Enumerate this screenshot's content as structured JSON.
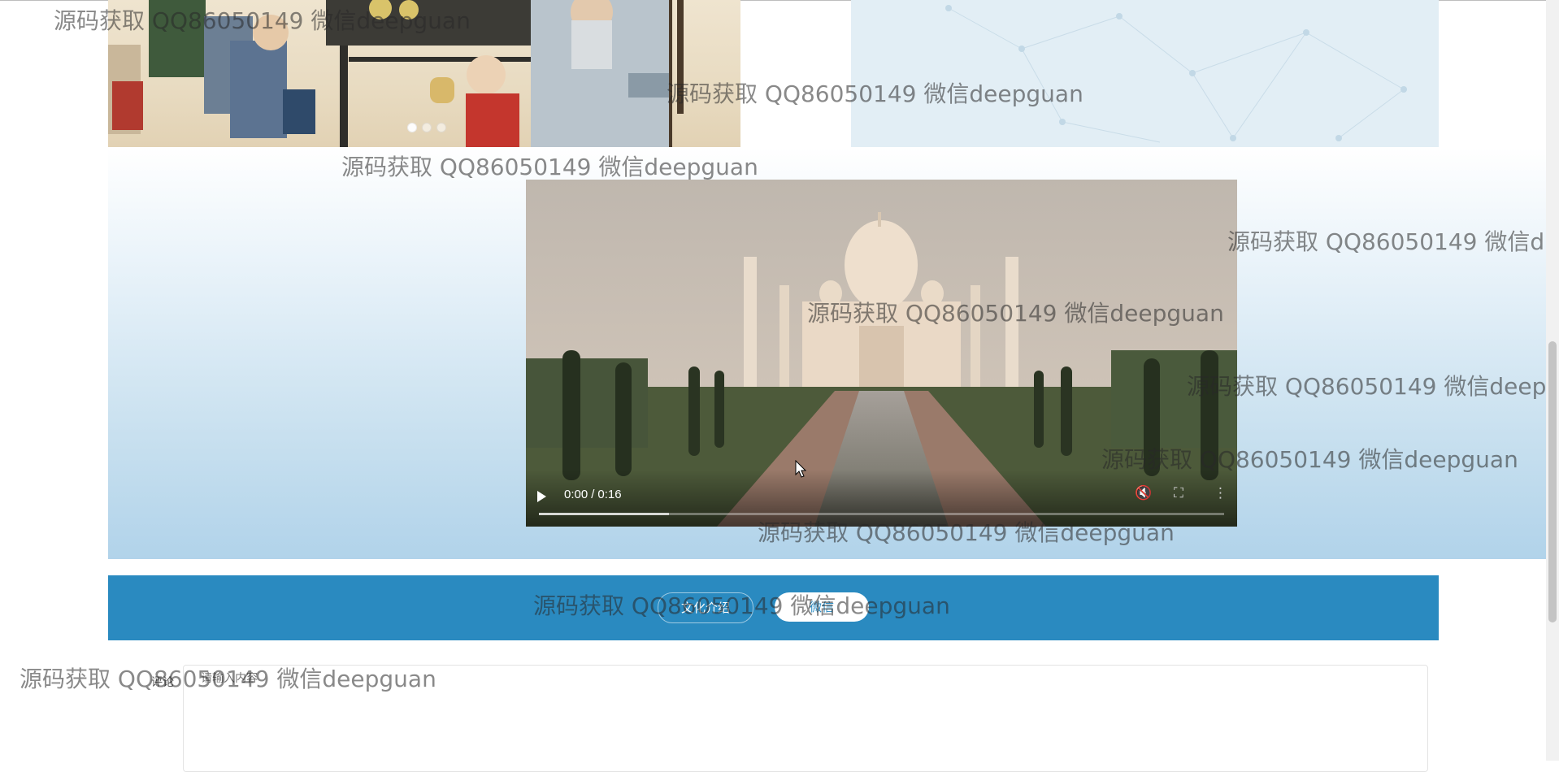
{
  "carousel": {
    "slides": 3,
    "active_index": 0
  },
  "video": {
    "current_time": "0:00",
    "duration": "0:16",
    "progress_fraction": 0.19,
    "play_icon": "play-icon",
    "volume_icon": "volume-icon",
    "fullscreen_icon": "fullscreen-icon",
    "more_icon": "more-vert-icon"
  },
  "tabs": {
    "culture_label": "文化介绍",
    "micro_label": "微信"
  },
  "comment": {
    "label": "评论",
    "placeholder": "请输入内容"
  },
  "watermark": {
    "text": "源码获取 QQ86050149 微信deepguan",
    "text_cut_1": "源码获取 QQ86050149 微信d",
    "text_cut_2": "源码获取 QQ86050149 微信deep"
  },
  "colors": {
    "tab_bar": "#2a8ac0",
    "section_gradient_bottom": "#b1d3ea",
    "network_panel": "#e2eef5"
  }
}
